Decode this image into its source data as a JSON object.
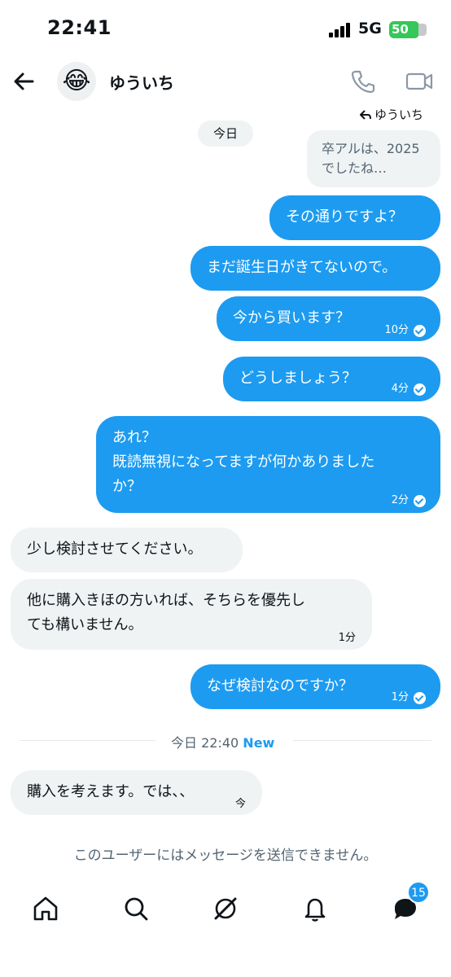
{
  "status_bar": {
    "time": "22:41",
    "network": "5G",
    "battery": "50"
  },
  "header": {
    "avatar_emoji": "😂",
    "name": "ゆういち"
  },
  "reply_to": "ゆういち",
  "date_chip": "今日",
  "quoted": {
    "line1": "卒アルは、2025",
    "line2": "でしたね…"
  },
  "messages": [
    {
      "dir": "out",
      "text": "その通りですよ？",
      "time": ""
    },
    {
      "dir": "out",
      "text": "まだ誕生日がきてないので。",
      "time": ""
    },
    {
      "dir": "out",
      "text": "今から買います？",
      "time": "10分"
    },
    {
      "dir": "out",
      "text": "どうしましょう？",
      "time": "4分"
    },
    {
      "dir": "out",
      "text": "あれ？\n既読無視になってますが何かありました\nか？",
      "time": "2分"
    },
    {
      "dir": "in",
      "text": "少し検討させてください。",
      "time": ""
    },
    {
      "dir": "in",
      "text": "他に購入きほの方いれば、そちらを優先し\nても構いません。",
      "time": "1分"
    },
    {
      "dir": "out",
      "text": "なぜ検討なのですか？",
      "time": "1分"
    },
    {
      "dir": "in",
      "text": "購入を考えます。では、、",
      "time": "今"
    }
  ],
  "divider": {
    "label": "今日 22:40",
    "new": "New"
  },
  "notice": "このユーザーにはメッセージを送信できません。",
  "nav": {
    "messages_badge": "15"
  },
  "colors": {
    "accent": "#1d9bf0",
    "bubble_in": "#eff3f4",
    "battery": "#34c759"
  },
  "icons": [
    "back-arrow-icon",
    "phone-icon",
    "video-icon",
    "reply-icon",
    "check-circle-icon",
    "home-icon",
    "search-icon",
    "grok-icon",
    "bell-icon",
    "messages-icon"
  ]
}
